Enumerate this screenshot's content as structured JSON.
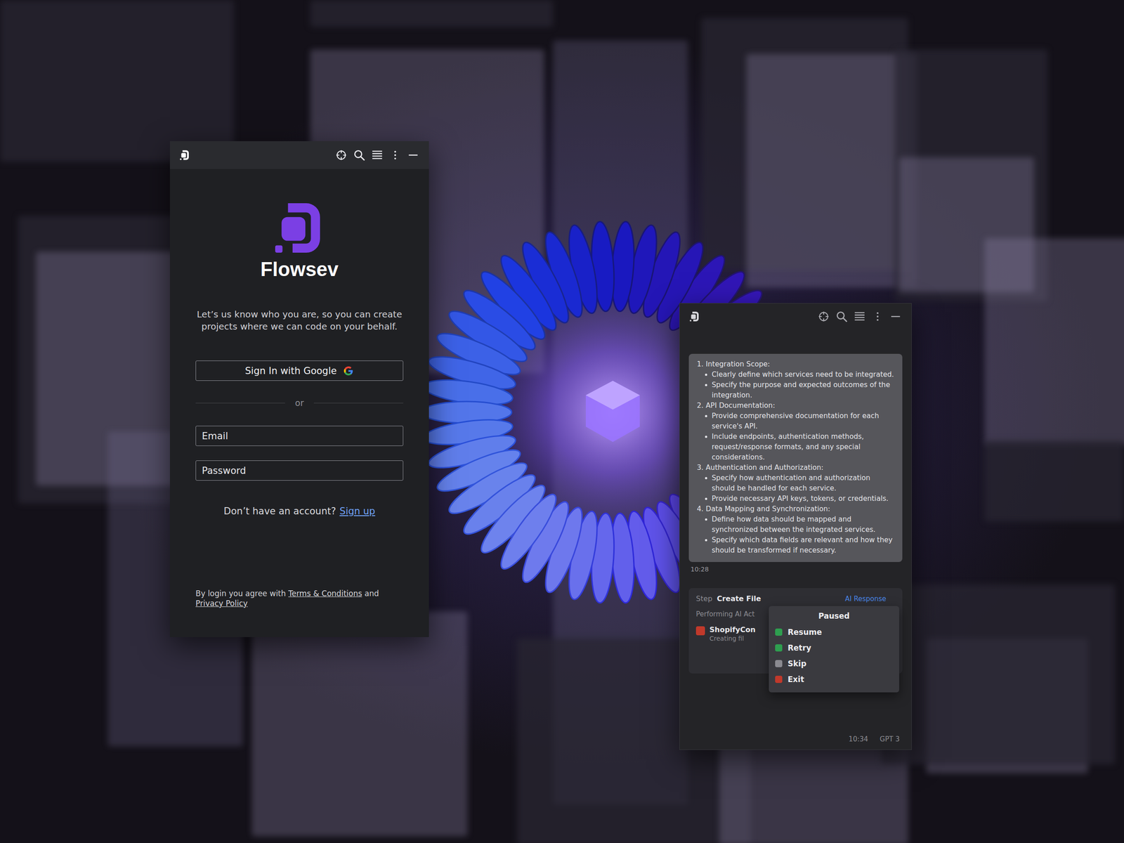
{
  "login_window": {
    "brand": "Flowsev",
    "tagline": "Let’s us know who you are, so you can create projects where we can code on your behalf.",
    "google_button": {
      "label": "Sign In with Google"
    },
    "divider": "or",
    "email": {
      "placeholder": "Email"
    },
    "password": {
      "placeholder": "Password"
    },
    "signup": {
      "prompt": "Don’t have an account?",
      "link": "Sign up"
    },
    "legal": {
      "prefix": "By login you agree with",
      "terms": "Terms & Conditions",
      "joiner": "and",
      "privacy": "Privacy Policy"
    }
  },
  "chat_window": {
    "message": {
      "sections": [
        {
          "title": "1. Integration Scope:",
          "points": [
            "Clearly define which services need to be integrated.",
            "Specify the purpose and expected outcomes of the integration."
          ]
        },
        {
          "title": "2. API Documentation:",
          "points": [
            "Provide comprehensive documentation for each service's API.",
            "Include endpoints, authentication methods, request/response formats, and any special considerations."
          ]
        },
        {
          "title": "3. Authentication and Authorization:",
          "points": [
            "Specify how authentication and authorization should be handled for each service.",
            "Provide necessary API keys, tokens, or credentials."
          ]
        },
        {
          "title": "4. Data Mapping and Synchronization:",
          "points": [
            "Define how data should be mapped and synchronized between the integrated services.",
            "Specify which data fields are relevant and how they should be transformed if necessary."
          ]
        }
      ],
      "time": "10:28"
    },
    "step": {
      "label": "Step",
      "title": "Create File",
      "badge": "AI Response",
      "status": "Performing AI Act",
      "file": "ShopifyCon",
      "file_status": "Creating fil"
    },
    "menu": {
      "title": "Paused",
      "items": [
        {
          "label": "Resume",
          "color": "#2e9e4f"
        },
        {
          "label": "Retry",
          "color": "#2e9e4f"
        },
        {
          "label": "Skip",
          "color": "#8a8a90"
        },
        {
          "label": "Exit",
          "color": "#c0392b"
        }
      ]
    },
    "footer": {
      "time": "10:34",
      "model": "GPT 3"
    }
  }
}
